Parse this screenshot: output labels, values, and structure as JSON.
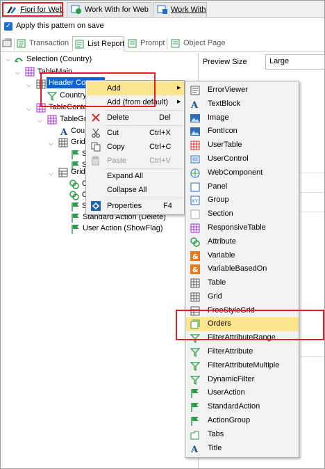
{
  "top_tabs": [
    {
      "label": "Fiori for Web",
      "active": true
    },
    {
      "label": "Work With for Web",
      "active": false
    },
    {
      "label": "Work With",
      "active": false
    }
  ],
  "apply_pattern": {
    "label": "Apply this pattern on save",
    "checked": true
  },
  "sub_tabs": [
    {
      "label": "Transaction",
      "active": false
    },
    {
      "label": "List Report",
      "active": true
    },
    {
      "label": "Prompt",
      "active": false
    },
    {
      "label": "Object Page",
      "active": false
    }
  ],
  "tree": [
    {
      "label": "Selection (Country)",
      "icon": "selection-icon"
    },
    {
      "label": "TableMain",
      "icon": "table-icon"
    },
    {
      "label": "Header Co",
      "icon": "grid-icon",
      "selected": true
    },
    {
      "label": "Country",
      "icon": "filter-icon"
    },
    {
      "label": "TableConte",
      "icon": "table-icon"
    },
    {
      "label": "TableGr",
      "icon": "table-icon"
    },
    {
      "label": "Cou",
      "icon": "attribute-icon"
    },
    {
      "label": "Grid",
      "icon": "grid-icon"
    },
    {
      "label": "S",
      "icon": "action-icon"
    },
    {
      "label": "S",
      "icon": "action-icon"
    },
    {
      "label": "Grid",
      "icon": "freestyle-grid-icon"
    },
    {
      "label": "C",
      "icon": "attribute-set-icon"
    },
    {
      "label": "C",
      "icon": "attribute-set-icon"
    },
    {
      "label": "S",
      "icon": "action-icon"
    },
    {
      "label": "Standard Action (Delete)",
      "icon": "action-icon"
    },
    {
      "label": "User Action (ShowFlag)",
      "icon": "action-icon"
    }
  ],
  "preview": {
    "label": "Preview Size",
    "value": "Large"
  },
  "context_menu": [
    {
      "label": "Add",
      "shortcut": "",
      "submenu": true,
      "highlighted": true
    },
    {
      "label": "Add (from default)",
      "shortcut": "",
      "submenu": true
    },
    {
      "label": "Delete",
      "shortcut": "Del",
      "icon": "delete-icon"
    },
    {
      "label": "Cut",
      "shortcut": "Ctrl+X",
      "icon": "cut-icon"
    },
    {
      "label": "Copy",
      "shortcut": "Ctrl+C",
      "icon": "copy-icon"
    },
    {
      "label": "Paste",
      "shortcut": "Ctrl+V",
      "icon": "paste-icon",
      "disabled": true
    },
    {
      "label": "Expand All",
      "shortcut": ""
    },
    {
      "label": "Collapse All",
      "shortcut": ""
    },
    {
      "label": "Properties",
      "shortcut": "F4",
      "icon": "properties-icon"
    }
  ],
  "add_submenu": [
    {
      "label": "ErrorViewer",
      "icon": "error-viewer-icon"
    },
    {
      "label": "TextBlock",
      "icon": "textblock-icon"
    },
    {
      "label": "Image",
      "icon": "image-icon"
    },
    {
      "label": "FontIcon",
      "icon": "font-icon-icon"
    },
    {
      "label": "UserTable",
      "icon": "usertable-icon"
    },
    {
      "label": "UserControl",
      "icon": "usercontrol-icon"
    },
    {
      "label": "WebComponent",
      "icon": "webcomponent-icon"
    },
    {
      "label": "Panel",
      "icon": "panel-icon"
    },
    {
      "label": "Group",
      "icon": "group-icon"
    },
    {
      "label": "Section",
      "icon": "section-icon"
    },
    {
      "label": "ResponsiveTable",
      "icon": "responsive-table-icon"
    },
    {
      "label": "Attribute",
      "icon": "attribute-icon"
    },
    {
      "label": "Variable",
      "icon": "variable-icon"
    },
    {
      "label": "VariableBasedOn",
      "icon": "variable-icon"
    },
    {
      "label": "Table",
      "icon": "table-icon"
    },
    {
      "label": "Grid",
      "icon": "grid-icon"
    },
    {
      "label": "FreeStyleGrid",
      "icon": "freestyle-grid-icon"
    },
    {
      "label": "Orders",
      "icon": "orders-icon",
      "highlighted": true
    },
    {
      "label": "FilterAttributeRange",
      "icon": "filter-icon"
    },
    {
      "label": "FilterAttribute",
      "icon": "filter-icon"
    },
    {
      "label": "FilterAttributeMultiple",
      "icon": "filter-icon"
    },
    {
      "label": "DynamicFilter",
      "icon": "filter-icon"
    },
    {
      "label": "UserAction",
      "icon": "flag-icon"
    },
    {
      "label": "StandardAction",
      "icon": "flag-icon"
    },
    {
      "label": "ActionGroup",
      "icon": "flag-icon"
    },
    {
      "label": "Tabs",
      "icon": "tabs-icon"
    },
    {
      "label": "Title",
      "icon": "title-icon"
    }
  ],
  "colors": {
    "accent": "#0a64d6",
    "highlight": "#fde58d",
    "annotation": "#e41e26"
  }
}
